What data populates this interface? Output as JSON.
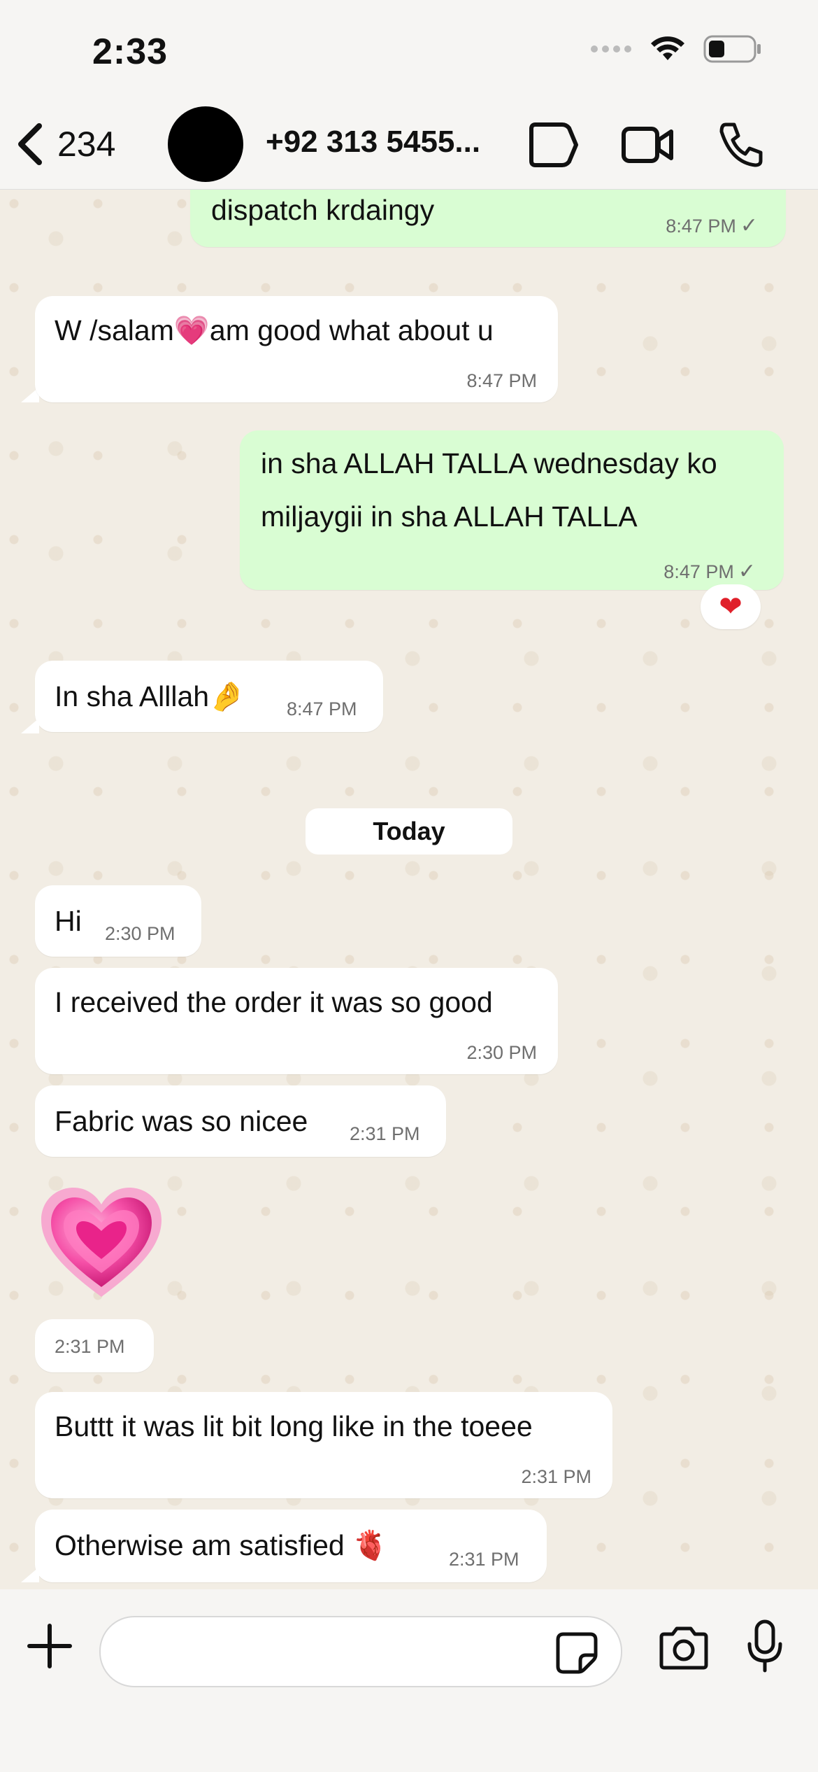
{
  "status_bar": {
    "time": "2:33"
  },
  "header": {
    "back_count": "234",
    "contact_name": "+92 313 5455..."
  },
  "messages": [
    {
      "dir": "out",
      "text": "dispatch krdaingy",
      "time": "8:47 PM"
    },
    {
      "dir": "in",
      "text_before": "W /salam",
      "emoji": "💗",
      "text_after": "am good what about u",
      "time": "8:47 PM"
    },
    {
      "dir": "out",
      "line1": "in sha ALLAH TALLA wednesday ko",
      "line2": "miljaygii in sha ALLAH TALLA",
      "time": "8:47 PM",
      "reaction": "❤"
    },
    {
      "dir": "in",
      "text": "In sha Alllah",
      "emoji": "🤌",
      "time": "8:47 PM"
    },
    {
      "dir": "in",
      "text": "Hi",
      "time": "2:30 PM"
    },
    {
      "dir": "in",
      "text": "I received the order it was so good",
      "time": "2:30 PM"
    },
    {
      "dir": "in",
      "text": "Fabric was so nicee",
      "time": "2:31 PM"
    },
    {
      "dir": "in",
      "sticker": "pink-heart",
      "time": "2:31 PM"
    },
    {
      "dir": "in",
      "text": "Buttt it was lit bit long like in the toeee",
      "time": "2:31 PM"
    },
    {
      "dir": "in",
      "text": "Otherwise am satisfied",
      "emoji": "🫀",
      "time": "2:31 PM"
    }
  ],
  "day_separator": "Today",
  "input": {
    "placeholder": ""
  },
  "colors": {
    "outgoing": "#d9fdd3",
    "incoming": "#ffffff",
    "background": "#f2ede4"
  }
}
